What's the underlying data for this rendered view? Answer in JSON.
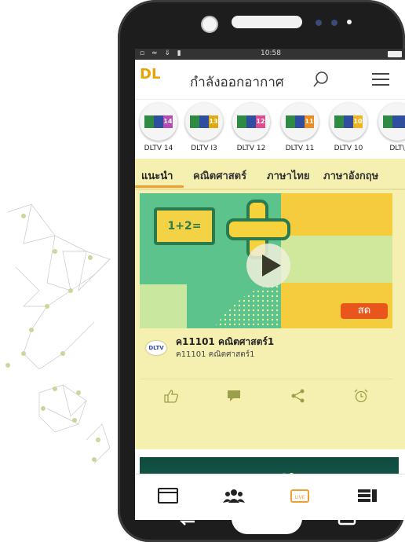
{
  "statusbar": {
    "time": "10:58"
  },
  "appbar": {
    "logo": "DL",
    "title": "กำลังออกอากาศ"
  },
  "channels": [
    {
      "num": "14",
      "name": "DLTV 14",
      "color": "#b54bb6"
    },
    {
      "num": "13",
      "name": "DLTV I3",
      "color": "#e2a90d"
    },
    {
      "num": "12",
      "name": "DLTV 12",
      "color": "#e04a8f"
    },
    {
      "num": "11",
      "name": "DLTV 11",
      "color": "#f08b1f"
    },
    {
      "num": "10",
      "name": "DLTV 10",
      "color": "#f2b21b"
    },
    {
      "num": "",
      "name": "DLT\\",
      "color": "#2f4ea0"
    }
  ],
  "tabs": [
    "แนะนำ",
    "คณิตศาสตร์",
    "ภาษาไทย",
    "ภาษาอังกฤษ"
  ],
  "video": {
    "math_text": "1+2=",
    "live_label": "สด",
    "title": "ค11101 คณิตศาสตร์1",
    "subtitle": "ค11101 คณิตศาสตร์1",
    "channel_logo": "DLTV"
  },
  "banner": {
    "text": "ภาษาไทย"
  },
  "colors": {
    "accent": "#f0a030",
    "card_bg": "#f6f0b0",
    "live": "#e9561b"
  }
}
